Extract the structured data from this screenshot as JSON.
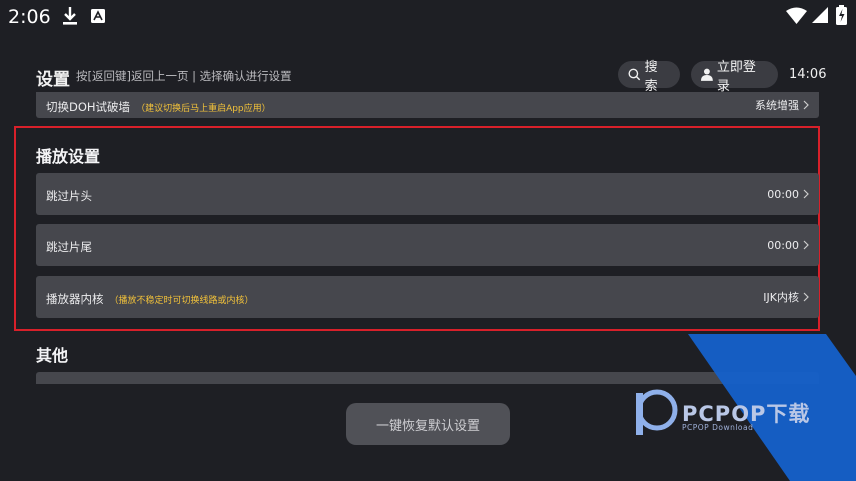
{
  "status_bar": {
    "time": "2:06"
  },
  "header": {
    "title": "设置",
    "hint": "按[返回键]返回上一页 | 选择确认进行设置",
    "search_label": "搜索",
    "login_label": "立即登录",
    "clock": "14:06"
  },
  "doh_row": {
    "label": "切换DOH试破墙",
    "note": "（建议切换后马上重启App应用）",
    "value": "系统增强"
  },
  "playback": {
    "title": "播放设置",
    "items": [
      {
        "label": "跳过片头",
        "note": "",
        "value": "00:00"
      },
      {
        "label": "跳过片尾",
        "note": "",
        "value": "00:00"
      },
      {
        "label": "播放器内核",
        "note": "（播放不稳定时可切换线路或内核）",
        "value": "IJK内核"
      }
    ]
  },
  "other": {
    "title": "其他"
  },
  "reset_button": "一键恢复默认设置",
  "watermark": {
    "brand": "PCPOP下载",
    "sub": "PCPOP Download"
  },
  "colors": {
    "background": "#1e1f24",
    "row": "#46474d",
    "highlight_border": "#d8202a",
    "note": "#f2c23a",
    "watermark": "#1560c9"
  }
}
